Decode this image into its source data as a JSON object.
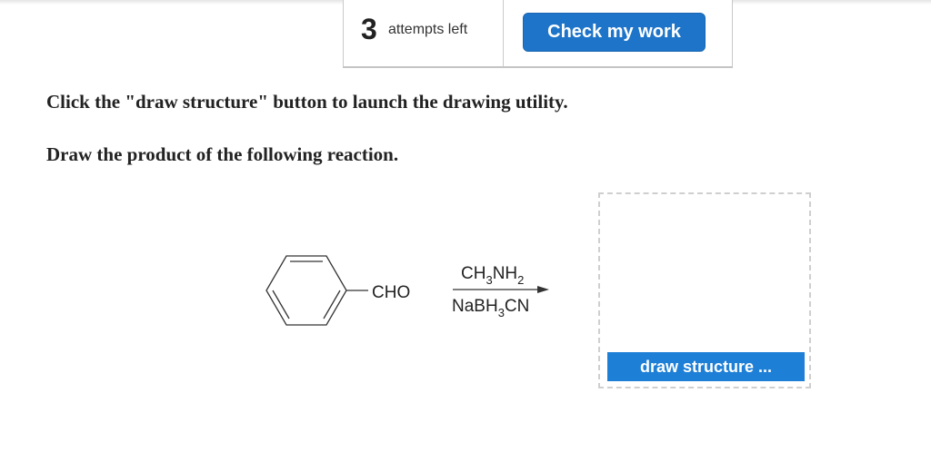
{
  "header": {
    "attempts_count": "3",
    "attempts_label": "attempts left",
    "check_button_label": "Check my work"
  },
  "question": {
    "instruction_1": "Click the \"draw structure\" button to launch the drawing utility.",
    "instruction_2": "Draw the product of the following reaction."
  },
  "reaction": {
    "substituent": "CHO",
    "reagent_top": {
      "main": "CH",
      "sub1": "3",
      "mid": "NH",
      "sub2": "2"
    },
    "reagent_bottom": {
      "main": "NaBH",
      "sub1": "3",
      "end": "CN"
    }
  },
  "answer_area": {
    "draw_button_label": "draw structure ..."
  },
  "colors": {
    "button_primary": "#1e74c8",
    "draw_button": "#1e7fd6",
    "dashed_border": "#cfcfcf"
  }
}
